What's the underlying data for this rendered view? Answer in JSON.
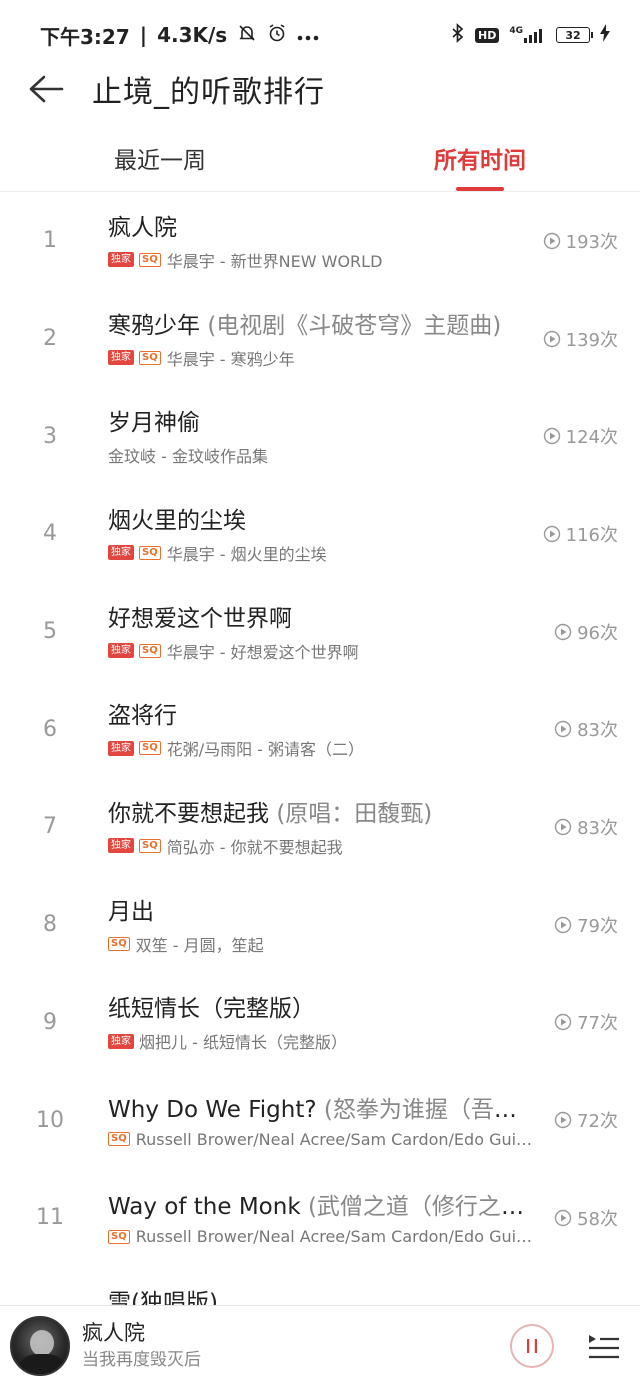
{
  "status_bar": {
    "time": "下午3:27",
    "separator": "|",
    "speed": "4.3K/s",
    "net_label": "4G",
    "hd_label": "HD",
    "battery": "32"
  },
  "header": {
    "title": "止境_的听歌排行"
  },
  "tabs": [
    {
      "label": "最近一周",
      "active": false
    },
    {
      "label": "所有时间",
      "active": true
    }
  ],
  "tags": {
    "exclusive": "独家",
    "sq": "SQ"
  },
  "songs": [
    {
      "rank": "1",
      "title": "疯人院",
      "alias": "",
      "artist": "华晨宇 - 新世界NEW WORLD",
      "plays": "193次"
    },
    {
      "rank": "2",
      "title": "寒鸦少年 ",
      "alias": "(电视剧《斗破苍穹》主题曲)",
      "artist": "华晨宇 - 寒鸦少年",
      "plays": "139次"
    },
    {
      "rank": "3",
      "title": "岁月神偷",
      "alias": "",
      "artist": "金玟岐 - 金玟岐作品集",
      "plays": "124次"
    },
    {
      "rank": "4",
      "title": "烟火里的尘埃",
      "alias": "",
      "artist": "华晨宇 - 烟火里的尘埃",
      "plays": "116次"
    },
    {
      "rank": "5",
      "title": "好想爱这个世界啊",
      "alias": "",
      "artist": "华晨宇 - 好想爱这个世界啊",
      "plays": "96次"
    },
    {
      "rank": "6",
      "title": "盗将行",
      "alias": "",
      "artist": "花粥/马雨阳 - 粥请客（二）",
      "plays": "83次"
    },
    {
      "rank": "7",
      "title": "你就不要想起我 ",
      "alias": "(原唱：田馥甄)",
      "artist": "简弘亦 - 你就不要想起我",
      "plays": "83次"
    },
    {
      "rank": "8",
      "title": "月出",
      "alias": "",
      "artist": "双笙 - 月圆，笙起",
      "plays": "79次"
    },
    {
      "rank": "9",
      "title": "纸短情长（完整版）",
      "alias": "",
      "artist": "烟把儿 - 纸短情长（完整版）",
      "plays": "77次"
    },
    {
      "rank": "10",
      "title": "Why Do We Fight? ",
      "alias": "(怒拳为谁握（吾辈...",
      "artist": "Russell Brower/Neal Acree/Sam Cardon/Edo Guid...",
      "plays": "72次"
    },
    {
      "rank": "11",
      "title": "Way of the Monk ",
      "alias": "(武僧之道（修行之路...",
      "artist": "Russell Brower/Neal Acree/Sam Cardon/Edo Guid...",
      "plays": "58次"
    },
    {
      "rank": "",
      "title": "雪(独唱版)",
      "alias": "",
      "artist": "",
      "plays": ""
    }
  ],
  "player": {
    "title": "疯人院",
    "subtitle": "当我再度毁灭后"
  }
}
